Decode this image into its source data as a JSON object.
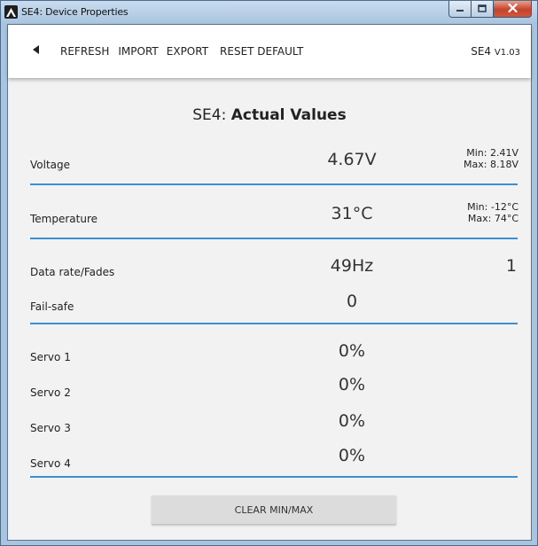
{
  "window": {
    "title": "SE4: Device Properties",
    "icon": "app-logo-icon",
    "controls": [
      "minimize-icon",
      "maximize-icon",
      "close-icon"
    ]
  },
  "toolbar": {
    "back_icon": "triangle-left-icon",
    "menu": [
      "REFRESH",
      "IMPORT",
      "EXPORT",
      "RESET DEFAULT"
    ],
    "device_name": "SE4",
    "device_version": "V1.03"
  },
  "heading": {
    "prefix": "SE4:",
    "title": "Actual Values"
  },
  "values": {
    "voltage": {
      "label": "Voltage",
      "value": "4.67V",
      "min": "Min: 2.41V",
      "max": "Max: 8.18V"
    },
    "temperature": {
      "label": "Temperature",
      "value": "31°C",
      "min": "Min: -12°C",
      "max": "Max: 74°C"
    },
    "data_rate": {
      "label": "Data rate/Fades",
      "value": "49Hz",
      "fades": "1"
    },
    "failsafe": {
      "label": "Fail-safe",
      "value": "0"
    },
    "servos": [
      {
        "label": "Servo 1",
        "value": "0%"
      },
      {
        "label": "Servo 2",
        "value": "0%"
      },
      {
        "label": "Servo 3",
        "value": "0%"
      },
      {
        "label": "Servo 4",
        "value": "0%"
      }
    ]
  },
  "clear_button": "CLEAR MIN/MAX",
  "colors": {
    "accent_divider": "#3b8fd3",
    "content_background": "#f2f2f2",
    "button_background": "#dcdcdc"
  }
}
